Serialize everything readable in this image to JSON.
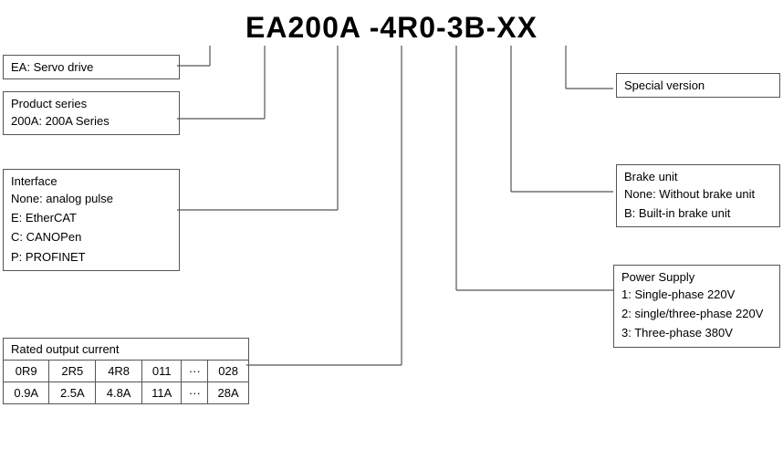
{
  "title": "EA200A -4R0-3B-XX",
  "ea_box": {
    "label": "EA: Servo drive"
  },
  "product_box": {
    "label": "Product series",
    "detail": "200A: 200A Series"
  },
  "interface_box": {
    "label": "Interface",
    "items": [
      "None: analog pulse",
      "E: EtherCAT",
      "C: CANOPen",
      "P: PROFINET"
    ]
  },
  "current_box": {
    "title": "Rated output current",
    "row1": [
      "0R9",
      "2R5",
      "4R8",
      "011",
      "···",
      "028"
    ],
    "row2": [
      "0.9A",
      "2.5A",
      "4.8A",
      "11A",
      "···",
      "28A"
    ]
  },
  "special_box": {
    "label": "Special version"
  },
  "brake_box": {
    "label": "Brake unit",
    "items": [
      "None: Without brake unit",
      "B: Built-in brake unit"
    ]
  },
  "power_box": {
    "label": "Power Supply",
    "items": [
      "1: Single-phase 220V",
      "2: single/three-phase 220V",
      "3: Three-phase 380V"
    ]
  }
}
